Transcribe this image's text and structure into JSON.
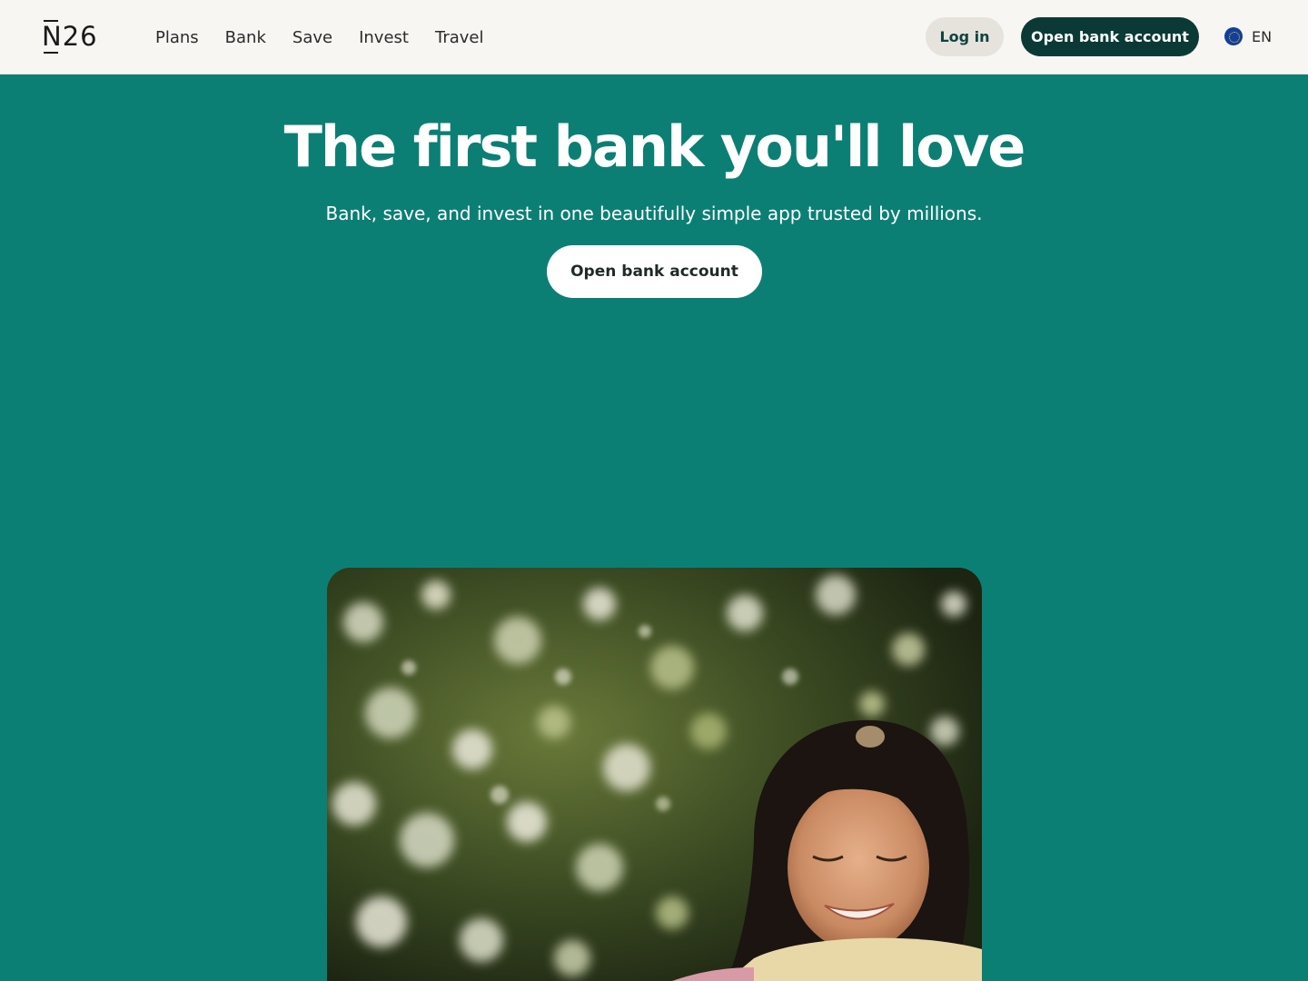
{
  "brand": {
    "logo_text": "N26"
  },
  "nav": {
    "items": [
      {
        "label": "Plans"
      },
      {
        "label": "Bank"
      },
      {
        "label": "Save"
      },
      {
        "label": "Invest"
      },
      {
        "label": "Travel"
      }
    ]
  },
  "header": {
    "login_label": "Log in",
    "open_account_label": "Open bank account",
    "language": "EN",
    "language_icon": "eu-flag-icon"
  },
  "hero": {
    "title": "The first bank you'll love",
    "subtitle": "Bank, save, and invest in one beautifully simple app trusted by millions.",
    "cta_label": "Open bank account",
    "image": "woman-smiling-under-tree-photo"
  },
  "colors": {
    "hero_background": "#0c7f75",
    "header_background": "#f8f6f3",
    "primary_dark": "#0b3a36",
    "login_background": "#e6e3dd"
  }
}
